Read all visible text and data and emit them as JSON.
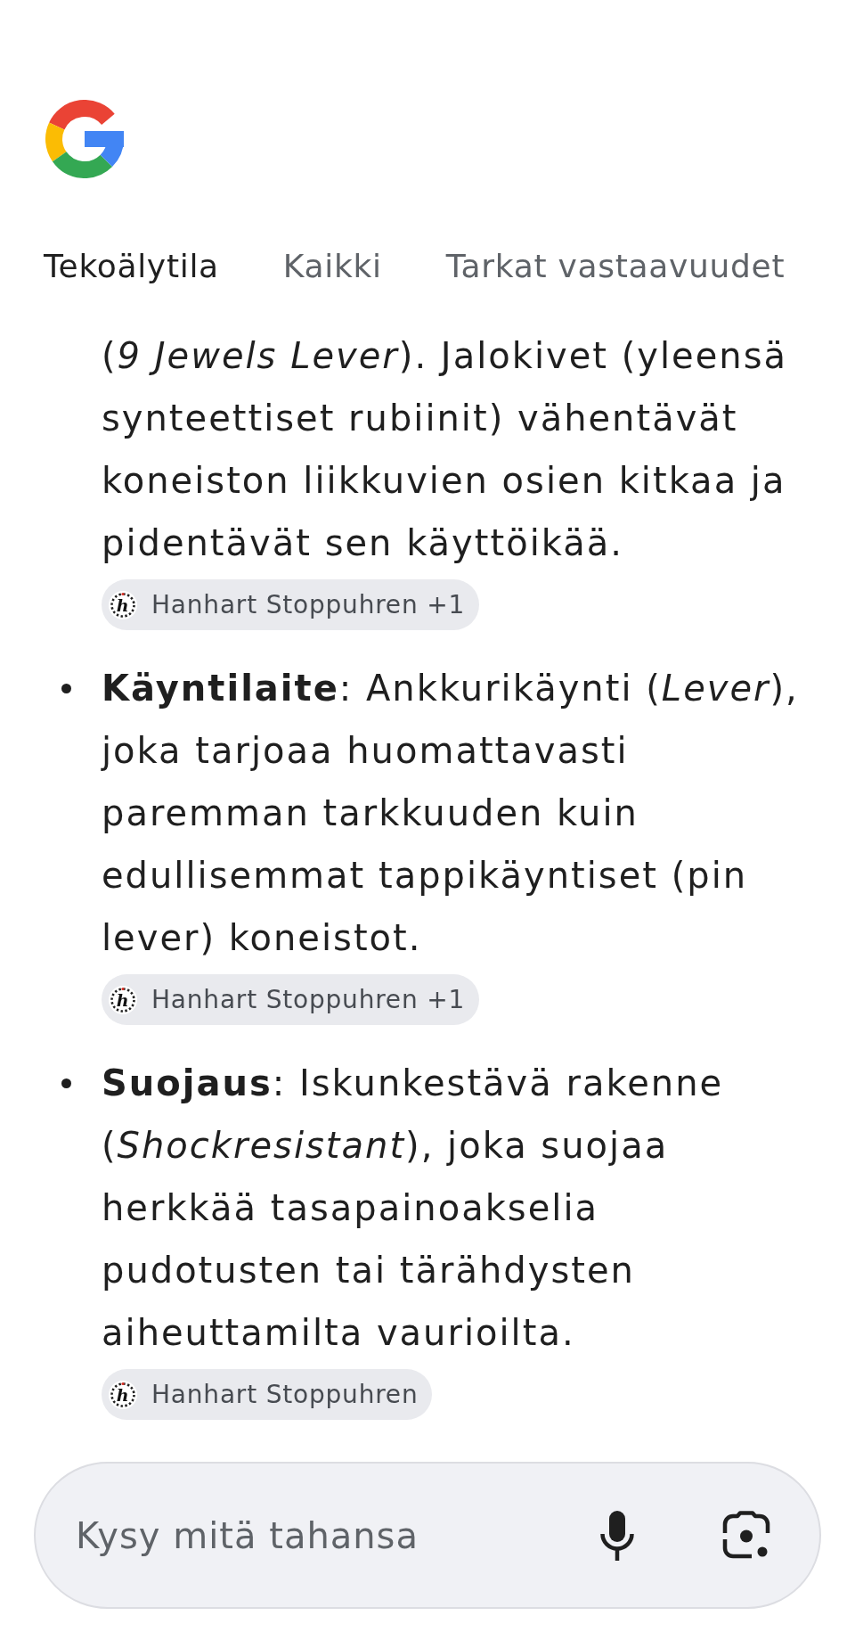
{
  "tabs": [
    {
      "label": "Tekoälytila",
      "selected": true
    },
    {
      "label": "Kaikki",
      "selected": false
    },
    {
      "label": "Tarkat vastaavuudet",
      "selected": false
    }
  ],
  "answer": [
    {
      "kind": "continuation",
      "text": "(*9 Jewels Lever*). Jalokivet (yleensä synteettiset rubiinit) vähentävät koneiston liikkuvien osien kitkaa ja pidentävät sen käyttöikää.",
      "source": {
        "label": "Hanhart Stoppuhren +1",
        "logo_letter": "h"
      }
    },
    {
      "kind": "bullet",
      "text": "**Käyntilaite**: Ankkurikäynti (*Lever*), joka tarjoaa huomattavasti paremman tarkkuuden kuin edullisemmat tappikäyntiset (pin lever) koneistot.",
      "source": {
        "label": "Hanhart Stoppuhren +1",
        "logo_letter": "h"
      }
    },
    {
      "kind": "bullet",
      "text": "**Suojaus**: Iskunkestävä rakenne (*Shockresistant*), joka suojaa herkkää tasapainoakselia pudotusten tai tärähdysten aiheuttamilta vaurioilta.",
      "source": {
        "label": "Hanhart Stoppuhren",
        "logo_letter": "h"
      }
    }
  ],
  "search": {
    "placeholder": "Kysy mitä tahansa"
  }
}
